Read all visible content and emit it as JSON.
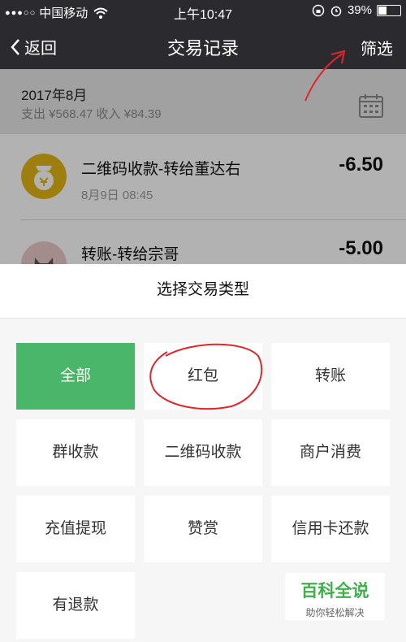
{
  "status_bar": {
    "signal": "●●●○○",
    "carrier": "中国移动",
    "time": "上午10:47",
    "battery_text": "39%",
    "battery_level": 0.39
  },
  "nav": {
    "back_label": "返回",
    "title": "交易记录",
    "filter_label": "筛选"
  },
  "month_header": {
    "month": "2017年8月",
    "summary": "支出 ¥568.47 收入 ¥84.39"
  },
  "transactions": [
    {
      "title": "二维码收款-转给董达右",
      "time": "8月9日 08:45",
      "amount": "-6.50",
      "icon": "money-bag-icon"
    },
    {
      "title": "转账-转给宗哥",
      "time": "",
      "amount": "-5.00",
      "icon": "cat-avatar"
    }
  ],
  "sheet": {
    "title": "选择交易类型",
    "options": [
      "全部",
      "红包",
      "转账",
      "群收款",
      "二维码收款",
      "商户消费",
      "充值提现",
      "赞赏",
      "信用卡还款",
      "有退款"
    ],
    "selected": "全部"
  },
  "watermark": {
    "title": "百科全说",
    "subtitle": "助你轻松解决"
  },
  "colors": {
    "accent_green": "#4ab66a",
    "nav_bg": "#2b2b2f",
    "icon_gold": "#e3b615",
    "annotation_red": "#e0262c"
  }
}
